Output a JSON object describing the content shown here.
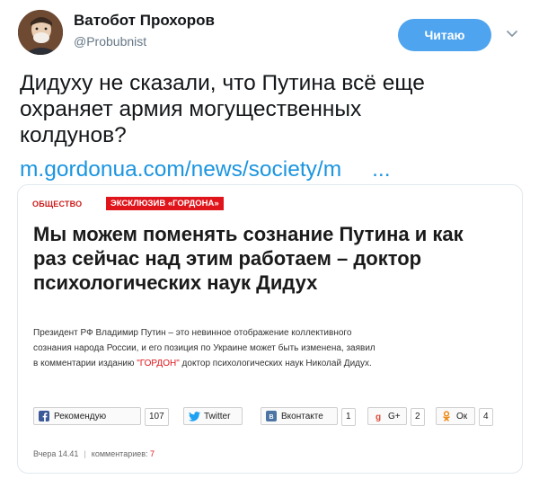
{
  "header": {
    "display_name": "Ватобот Прохоров",
    "screen_name": "@Probubnist",
    "follow_label": "Читаю"
  },
  "tweet": {
    "text_lines": [
      "Дидуху не сказали, что Путина всё еще",
      "охраняет армия могущественных",
      "колдунов?"
    ],
    "link_text": "m.gordonua.com/news/society/m",
    "link_ellipsis": "..."
  },
  "card": {
    "category": "ОБЩЕСТВО",
    "exclusive": "ЭКСКЛЮЗИВ «ГОРДОНА»",
    "headline_lines": [
      "Мы можем поменять сознание Путина и как",
      "раз сейчас над этим работаем – доктор",
      "психологических наук Дидух"
    ],
    "lead_line1": "Президент РФ Владимир Путин – это невинное отображение коллективного",
    "lead_line2": "сознания народа России, и его позиция по Украине может быть изменена, заявил",
    "lead_line3_a": "в комментарии изданию ",
    "lead_line3_brand": "\"ГОРДОН\"",
    "lead_line3_b": " доктор психологических наук Николай Дидух.",
    "shares": {
      "facebook": {
        "label": "Рекомендую",
        "count": "107",
        "icon": "facebook-icon"
      },
      "twitter": {
        "label": "Twitter",
        "icon": "twitter-icon"
      },
      "vk": {
        "label": "Вконтакте",
        "count": "1",
        "icon": "vk-icon"
      },
      "gplus": {
        "label": "G+",
        "count": "2",
        "icon": "google-plus-icon"
      },
      "ok": {
        "label": "Ок",
        "count": "4",
        "icon": "odnoklassniki-icon"
      }
    },
    "meta": {
      "date": "Вчера 14.41",
      "separator": "|",
      "comments_label": "комментариев:",
      "comments_count": "7"
    }
  },
  "colors": {
    "follow_button": "#4ea4ee",
    "link": "#1b95e0",
    "accent_red": "#e0141b"
  }
}
